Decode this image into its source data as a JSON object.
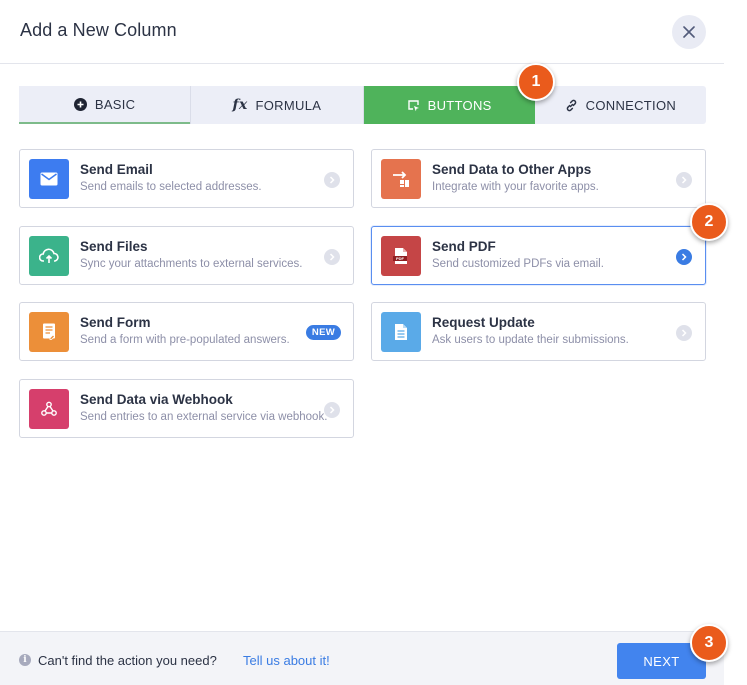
{
  "dialog": {
    "title": "Add a New Column"
  },
  "tabs": [
    {
      "label": "BASIC",
      "icon": "plus-circle-icon"
    },
    {
      "label": "FORMULA",
      "icon": "fx-icon"
    },
    {
      "label": "BUTTONS",
      "icon": "cursor-box-icon",
      "active": true
    },
    {
      "label": "CONNECTION",
      "icon": "link-icon"
    }
  ],
  "cards": [
    {
      "title": "Send Email",
      "desc": "Send emails to selected addresses.",
      "icon": "envelope-icon",
      "color": "#3d7cf0"
    },
    {
      "title": "Send Data to Other Apps",
      "desc": "Integrate with your favorite apps.",
      "icon": "transfer-icon",
      "color": "#e5734e"
    },
    {
      "title": "Send Files",
      "desc": "Sync your attachments to external services.",
      "icon": "cloud-upload-icon",
      "color": "#3bb38b"
    },
    {
      "title": "Send PDF",
      "desc": "Send customized PDFs via email.",
      "icon": "pdf-icon",
      "color": "#c54546",
      "selected": true
    },
    {
      "title": "Send Form",
      "desc": "Send a form with pre-populated answers.",
      "icon": "form-icon",
      "color": "#ec8f39",
      "badge": "NEW"
    },
    {
      "title": "Request Update",
      "desc": "Ask users to update their submissions.",
      "icon": "document-icon",
      "color": "#5aaae8"
    },
    {
      "title": "Send Data via Webhook",
      "desc": "Send entries to an external service via webhook.",
      "icon": "webhook-icon",
      "color": "#d63f6c"
    }
  ],
  "steps": [
    "1",
    "2",
    "3"
  ],
  "footer": {
    "help_text": "Can't find the action you need?",
    "help_link": "Tell us about it!",
    "next_label": "NEXT"
  },
  "colors": {
    "active_tab": "#4fb35b",
    "primary": "#4284ee",
    "step_badge": "#ea5b1c"
  }
}
